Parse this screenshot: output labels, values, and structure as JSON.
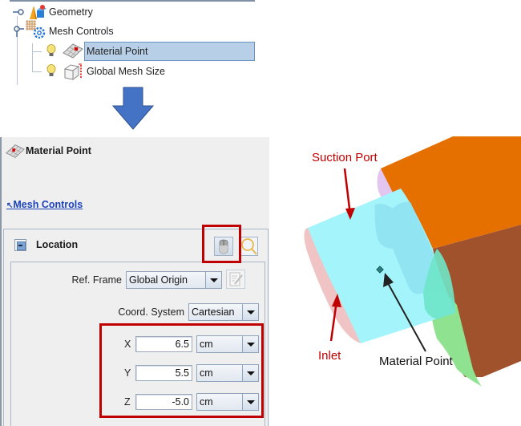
{
  "tree": {
    "items": [
      {
        "label": "Geometry",
        "icon": "geometry-icon",
        "expander": "collapsed-key-icon"
      },
      {
        "label": "Mesh Controls",
        "icon": "mesh-controls-icon",
        "expander": "expanded-key-icon"
      },
      {
        "label": "Material Point",
        "icon": "material-point-icon",
        "visibility_icon": "lightbulb-icon",
        "selected": true
      },
      {
        "label": "Global Mesh Size",
        "icon": "global-mesh-size-icon",
        "visibility_icon": "lightbulb-icon",
        "selected": false
      }
    ]
  },
  "arrow": {
    "icon": "down-arrow-icon",
    "color": "#4472c4"
  },
  "panel": {
    "title": "Material Point",
    "title_icon": "material-point-icon",
    "back_link": "Mesh Controls",
    "back_link_icon": "back-arrow-icon",
    "location": {
      "title": "Location",
      "collapse_icon": "collapse-icon",
      "pick_button_icon": "mouse-pick-icon",
      "zoom_button_icon": "magnifier-icon",
      "ref_frame": {
        "label": "Ref. Frame",
        "value": "Global Origin",
        "edit_icon": "edit-icon"
      },
      "coord_system": {
        "label": "Coord. System",
        "value": "Cartesian"
      },
      "coords": [
        {
          "axis": "X",
          "value": "6.5",
          "unit": "cm"
        },
        {
          "axis": "Y",
          "value": "5.5",
          "unit": "cm"
        },
        {
          "axis": "Z",
          "value": "-5.0",
          "unit": "cm"
        }
      ]
    }
  },
  "viewport": {
    "annotations": {
      "suction_port": "Suction Port",
      "inlet": "Inlet",
      "material_point": "Material Point"
    },
    "colors": {
      "highlight": "#c00000",
      "inlet_face": "#f0c4c4",
      "pipe": "#a3f5fb",
      "suction_face": "#e2c6f0",
      "orange_body": "#e57000",
      "brown_body": "#a0522d",
      "green_body": "#8fe28f",
      "teal_ring": "#6ee6c8"
    }
  }
}
